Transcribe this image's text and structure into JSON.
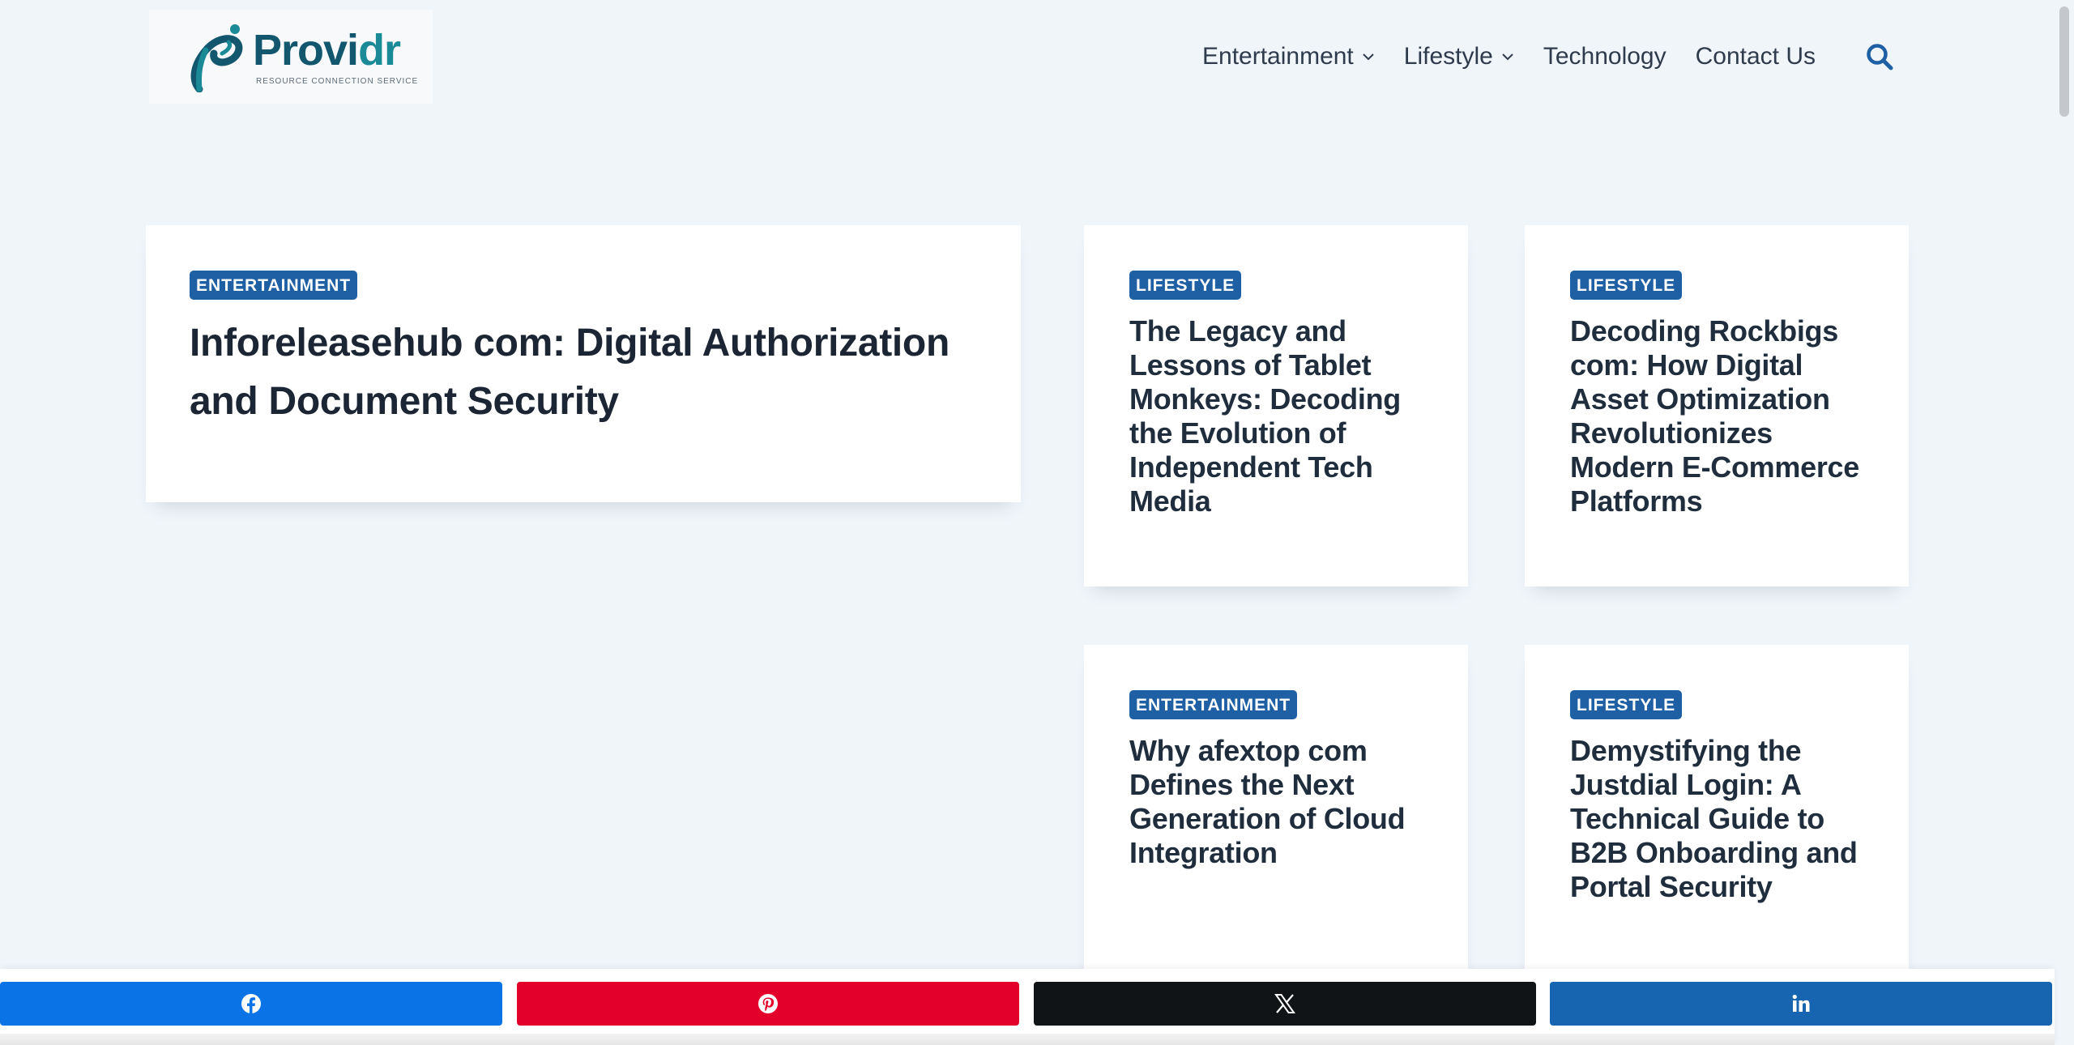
{
  "header": {
    "logo": {
      "word_main": "Provi",
      "word_accent": "dr",
      "tagline": "RESOURCE CONNECTION SERVICE"
    },
    "nav": [
      {
        "label": "Entertainment",
        "has_dropdown": true
      },
      {
        "label": "Lifestyle",
        "has_dropdown": true
      },
      {
        "label": "Technology",
        "has_dropdown": false
      },
      {
        "label": "Contact Us",
        "has_dropdown": false
      }
    ],
    "search_icon": "search-icon"
  },
  "featured": {
    "category": "ENTERTAINMENT",
    "title": "Inforeleasehub com: Digital Authorization and Document Security"
  },
  "cards": [
    {
      "category": "LIFESTYLE",
      "title": "The Legacy and Lessons of Tablet Monkeys: Decoding the Evolution of Independent Tech Media"
    },
    {
      "category": "LIFESTYLE",
      "title": "Decoding Rockbigs com: How Digital Asset Optimization Revolutionizes Modern E-Commerce Platforms"
    },
    {
      "category": "ENTERTAINMENT",
      "title": "Why afextop com Defines the Next Generation of Cloud Integration"
    },
    {
      "category": "LIFESTYLE",
      "title": "Demystifying the Justdial Login: A Technical Guide to B2B Onboarding and Portal Security"
    }
  ],
  "share": [
    {
      "network": "facebook",
      "icon": "facebook-icon",
      "color": "#0a73e6"
    },
    {
      "network": "pinterest",
      "icon": "pinterest-icon",
      "color": "#e3002a"
    },
    {
      "network": "x",
      "icon": "x-icon",
      "color": "#111416"
    },
    {
      "network": "linkedin",
      "icon": "linkedin-icon",
      "color": "#1764b0"
    }
  ],
  "colors": {
    "badge": "#1f5fa3",
    "background": "#f0f5fa",
    "brand": "#12576e"
  }
}
